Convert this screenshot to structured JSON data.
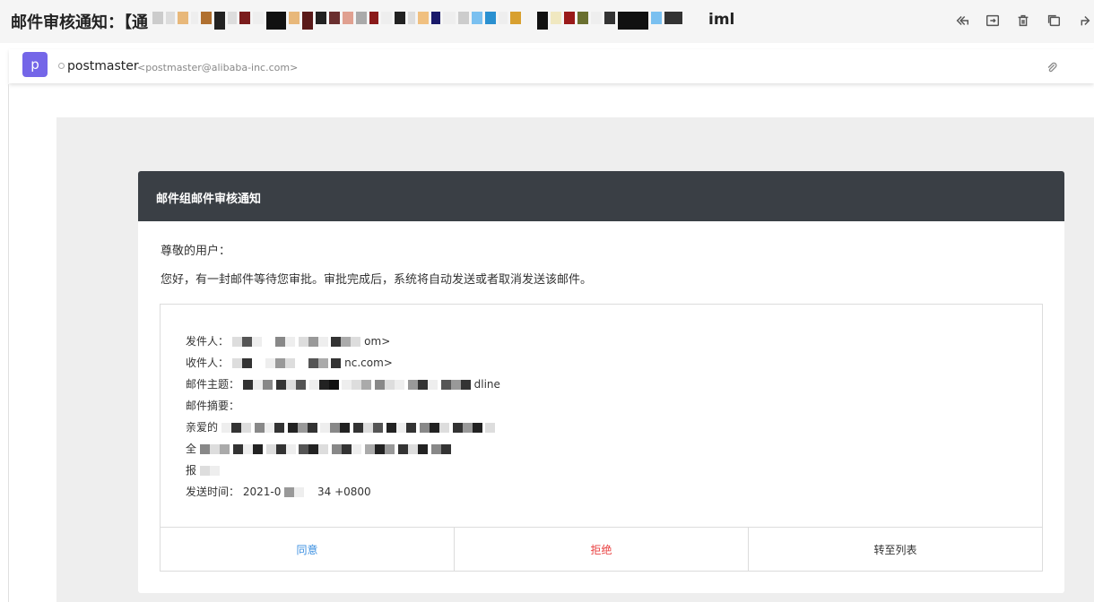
{
  "header": {
    "subject_prefix": "邮件审核通知：【通",
    "subject_suffix": "iml"
  },
  "toolbar": {
    "icons": [
      "reply-all-icon",
      "move-icon",
      "delete-icon",
      "copy-icon",
      "forward-icon"
    ]
  },
  "sender": {
    "avatar_letter": "p",
    "name": "postmaster",
    "email": "<postmaster@alibaba-inc.com>"
  },
  "card": {
    "title": "邮件组邮件审核通知",
    "greeting": "尊敬的用户：",
    "intro": "您好，有一封邮件等待您审批。审批完成后，系统将自动发送或者取消发送该邮件。",
    "sender_label": "发件人：",
    "sender_value_tail": "om>",
    "recipient_label": "收件人：",
    "recipient_value_tail": "nc.com>",
    "subject_label": "邮件主题：",
    "subject_value_tail": "dline",
    "summary_label": "邮件摘要：",
    "summary_line1_prefix": "亲爱的",
    "summary_line2_prefix": "全",
    "summary_line3_prefix": "报",
    "sent_time_label": "发送时间：",
    "sent_time_prefix": "2021-0",
    "sent_time_suffix": "34 +0800"
  },
  "actions": {
    "agree": "同意",
    "reject": "拒绝",
    "to_list": "转至列表"
  }
}
